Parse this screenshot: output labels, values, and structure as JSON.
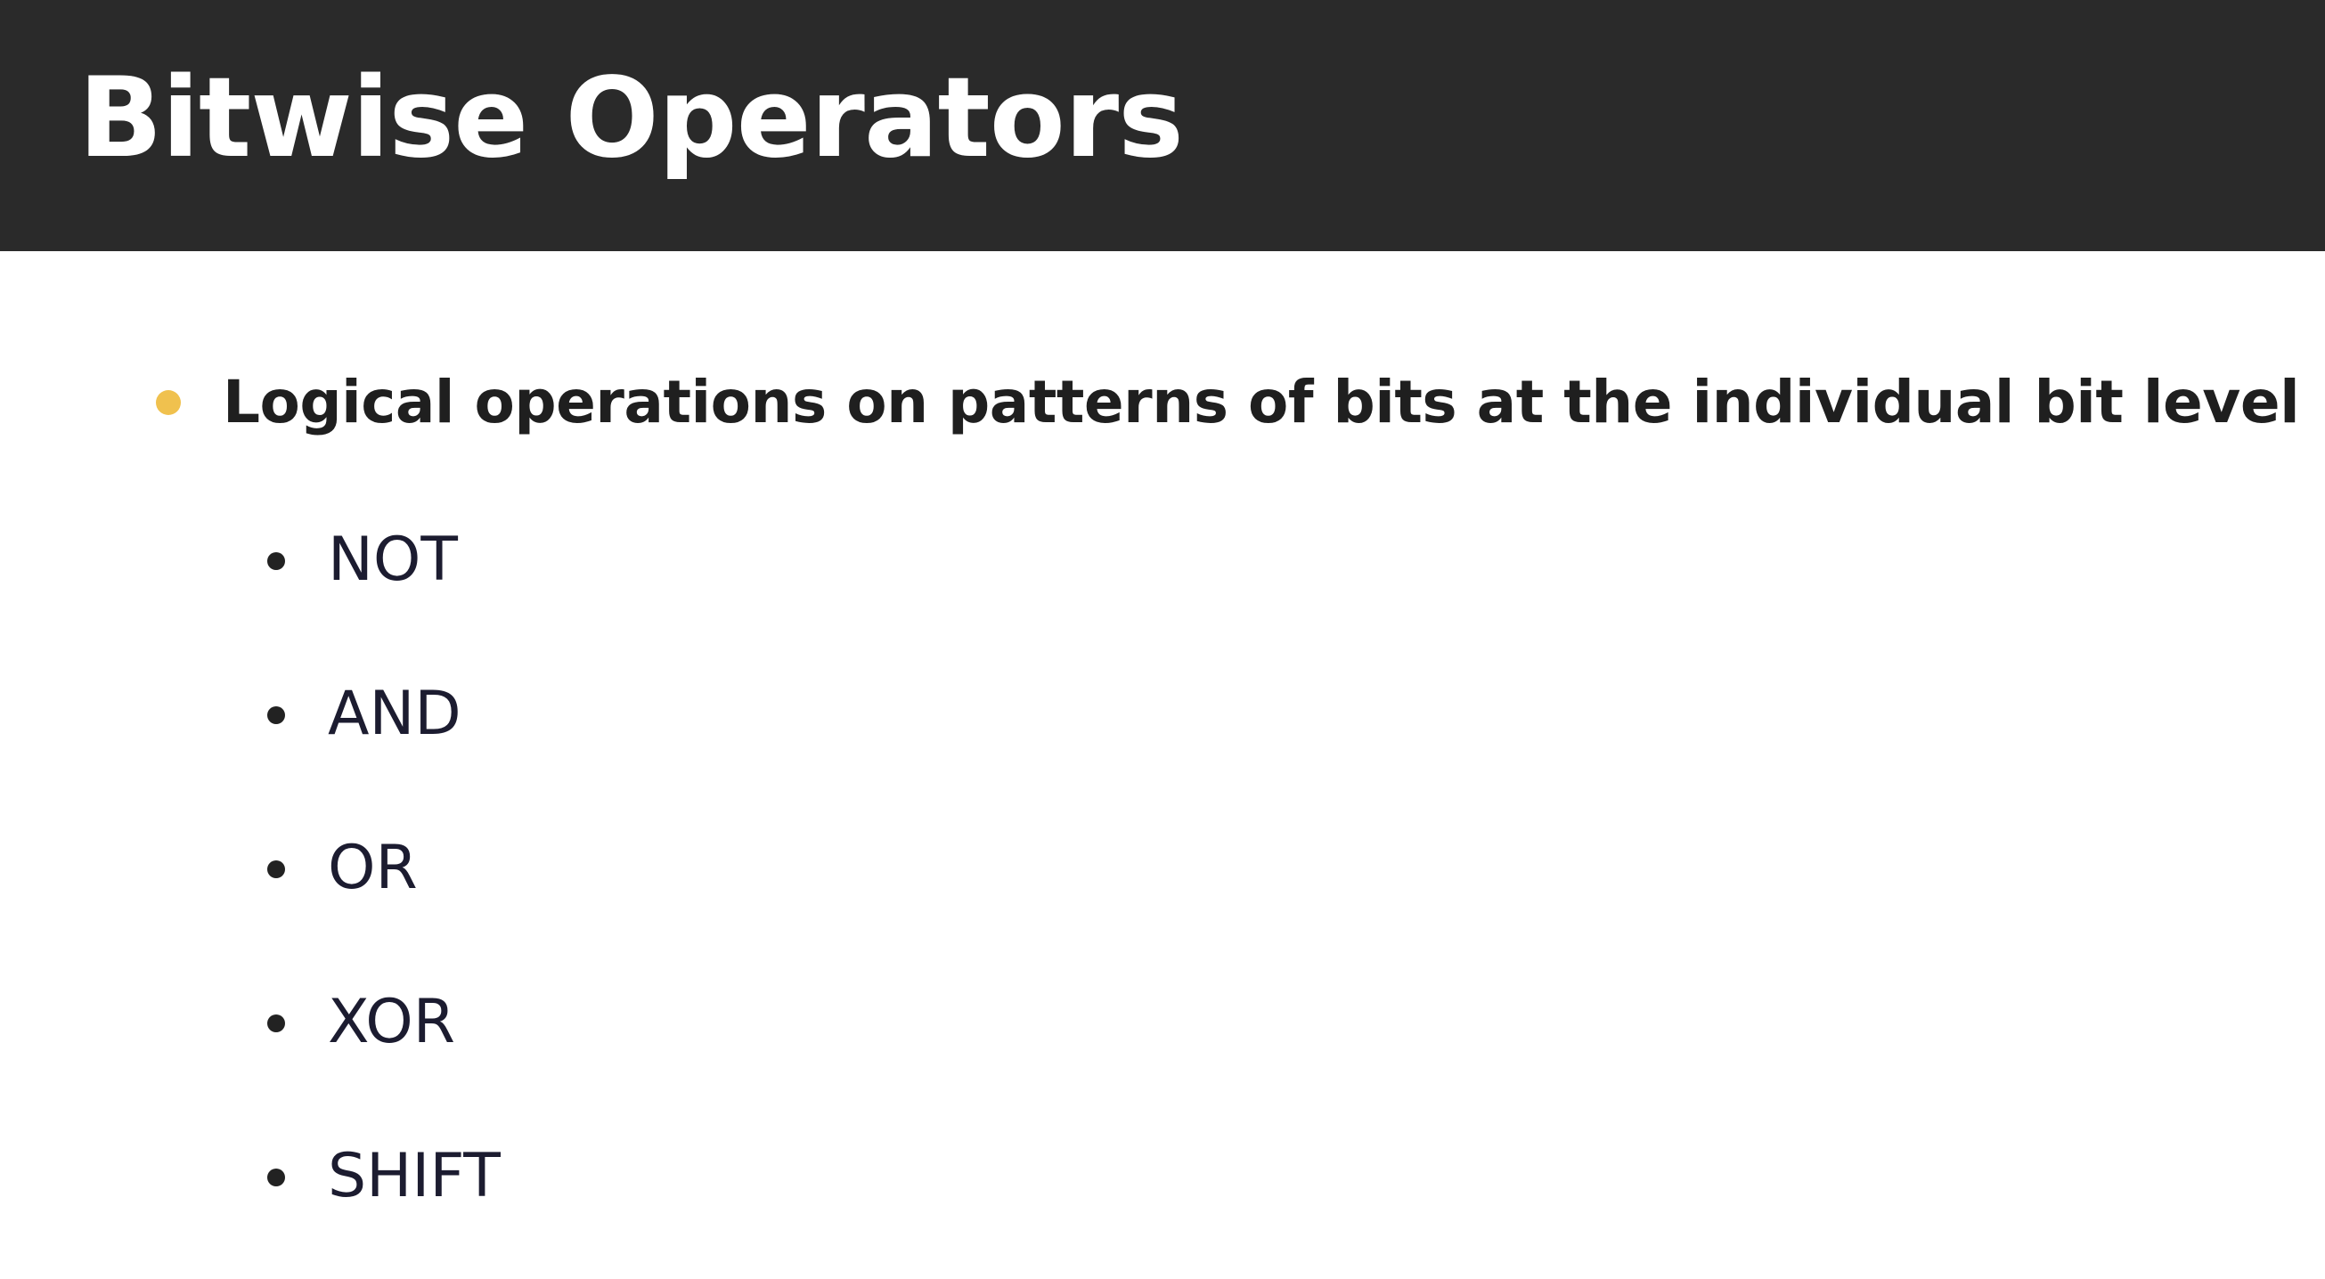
{
  "slide": {
    "title": "Bitwise Operators",
    "main_point": "Logical operations on patterns of bits at the individual bit level",
    "sub_points": [
      "NOT",
      "AND",
      "OR",
      "XOR",
      "SHIFT"
    ],
    "colors": {
      "title_bar": "#2a2a2a",
      "title_text": "#ffffff",
      "main_bullet": "#f0c14e",
      "body_text": "#1f1f1f",
      "sub_bullet": "#222222",
      "background": "#ffffff"
    }
  }
}
